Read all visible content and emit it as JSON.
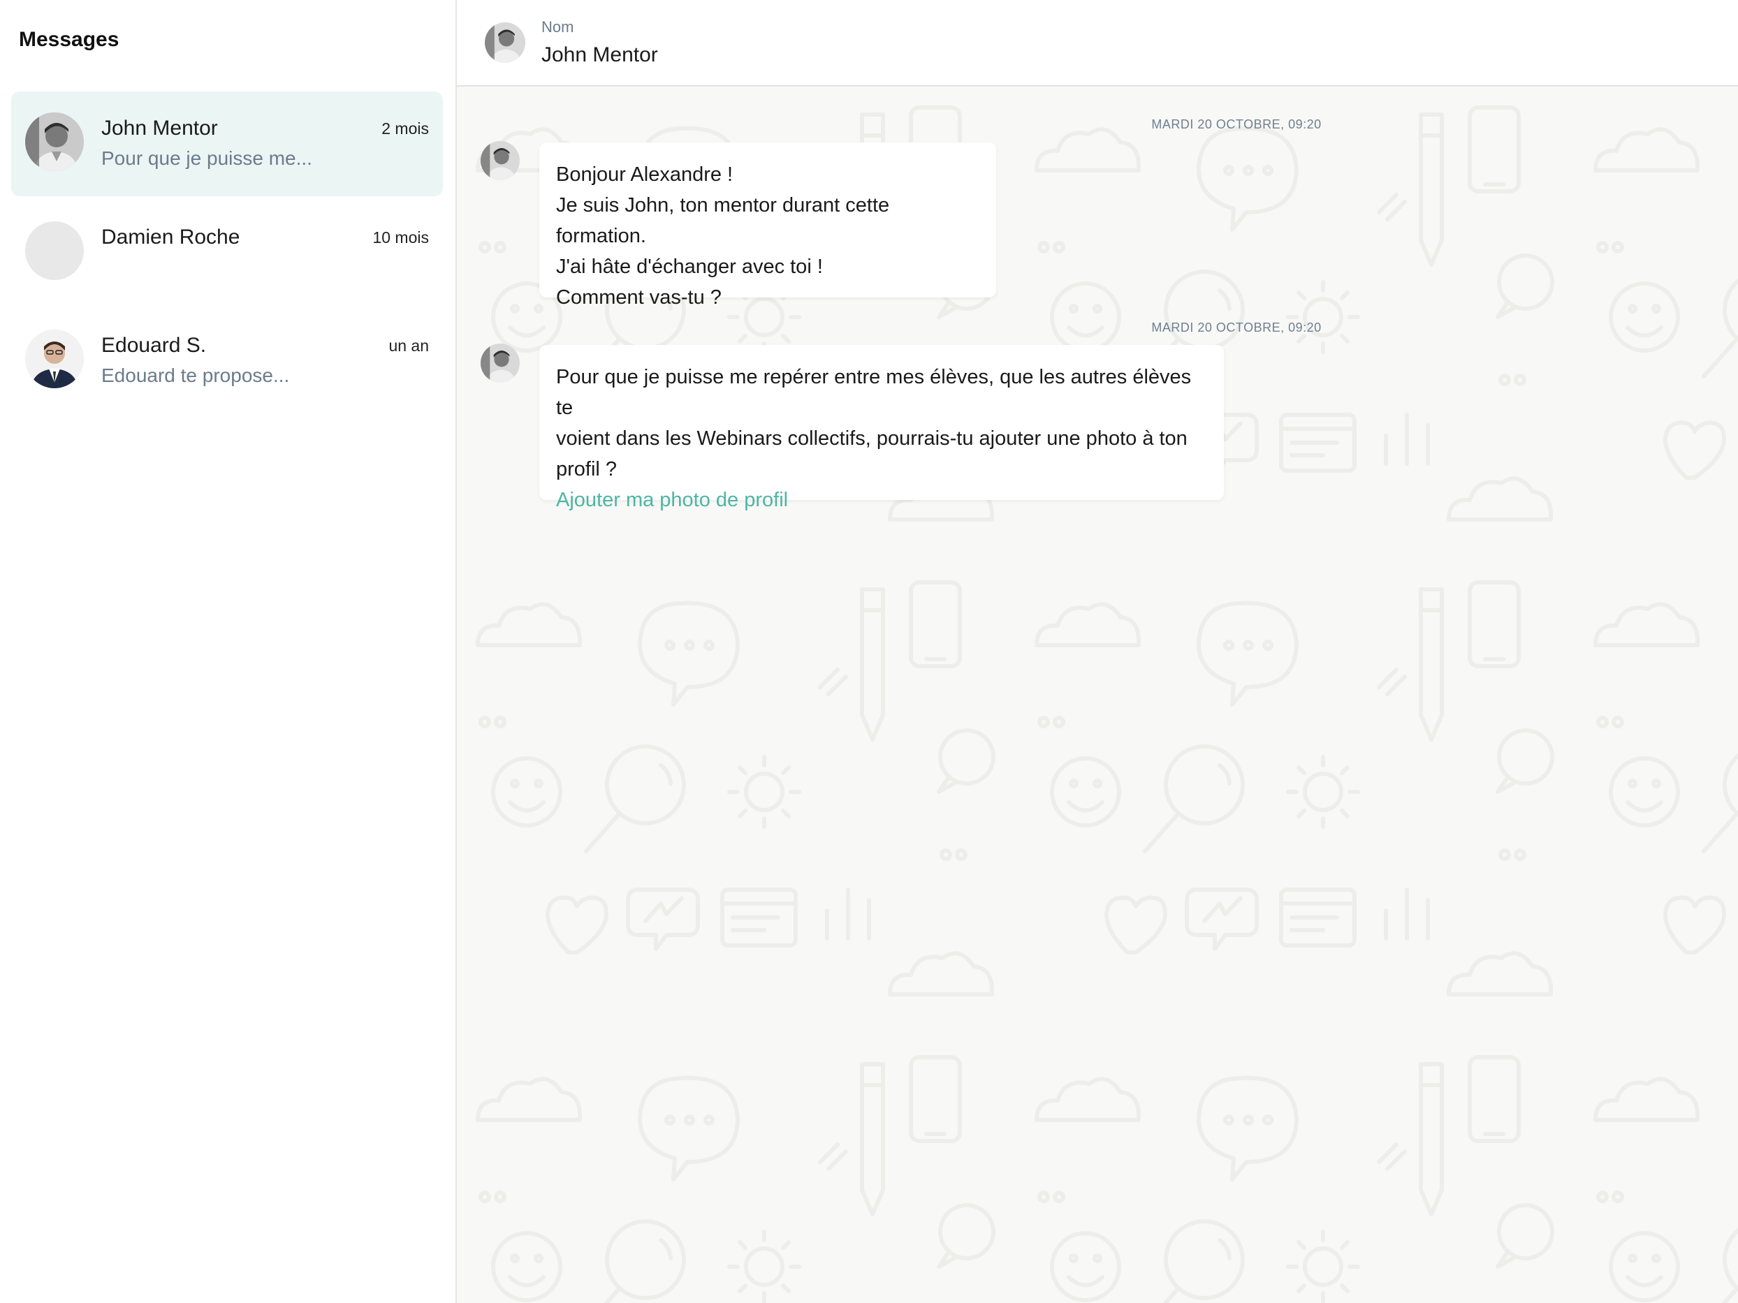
{
  "sidebar": {
    "title": "Messages",
    "conversations": [
      {
        "name": "John Mentor",
        "time": "2 mois",
        "preview": "Pour que je puisse me...",
        "active": true
      },
      {
        "name": "Damien Roche",
        "time": "10 mois",
        "preview": ""
      },
      {
        "name": "Edouard S.",
        "time": "un an",
        "preview": "Edouard te propose..."
      }
    ]
  },
  "header": {
    "label": "Nom",
    "name": "John Mentor"
  },
  "messages": [
    {
      "timestamp": "MARDI 20 OCTOBRE, 09:20",
      "lines": [
        "Bonjour Alexandre !",
        "Je suis John, ton mentor durant cette formation.",
        "J'ai hâte d'échanger avec toi !",
        "Comment vas-tu ?"
      ]
    },
    {
      "timestamp": "MARDI 20 OCTOBRE, 09:20",
      "lines": [
        "Pour que je puisse me repérer entre mes élèves, que les autres élèves te",
        "voient dans les Webinars collectifs, pourrais-tu ajouter une photo à ton",
        "profil ?"
      ],
      "link": "Ajouter ma photo de profil"
    }
  ],
  "colors": {
    "active_conversation_bg": "#ebf5f4",
    "link": "#4db6a4",
    "secondary_text": "#6b7b8c",
    "chat_bg": "#f8f8f6"
  }
}
